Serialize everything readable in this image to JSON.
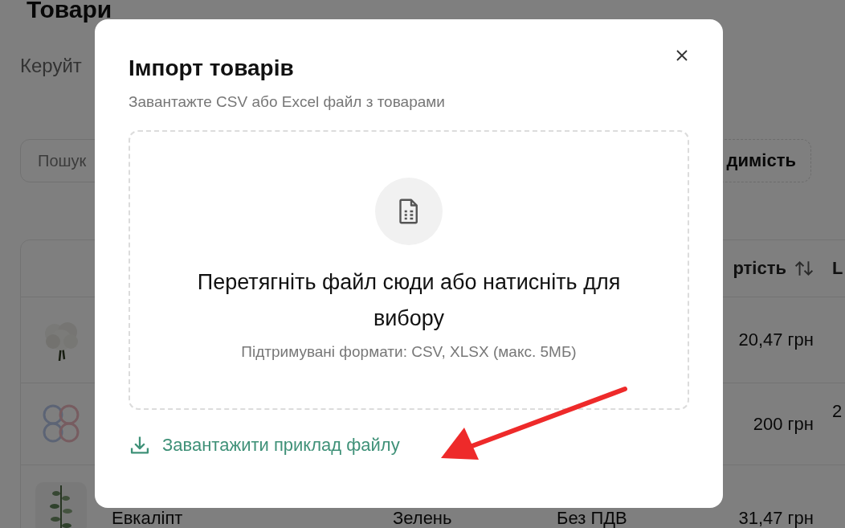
{
  "page": {
    "title": "Товари",
    "subtitle": "Керуйт",
    "search": {
      "placeholder": "Пошук"
    },
    "visibility_button": "димість",
    "table": {
      "columns": [
        {
          "label": "ртість",
          "sortable": true
        },
        {
          "label": "L",
          "sortable": false
        }
      ],
      "rows": [
        {
          "price": "20,47 грн"
        },
        {
          "price": "200 грн",
          "column_6": "2"
        },
        {
          "name": "Евкаліпт",
          "category": "Зелень",
          "vat": "Без ПДВ",
          "price": "31,47 грн"
        }
      ]
    }
  },
  "modal": {
    "title": "Імпорт товарів",
    "description": "Завантажте CSV або Excel файл з товарами",
    "dropzone": {
      "prompt": "Перетягніть файл сюди або натисніть для вибору",
      "hint": "Підтримувані формати: CSV, XLSX (макс. 5МБ)"
    },
    "download_link": "Завантажити приклад файлу"
  },
  "annotation": {
    "kind": "arrow"
  }
}
